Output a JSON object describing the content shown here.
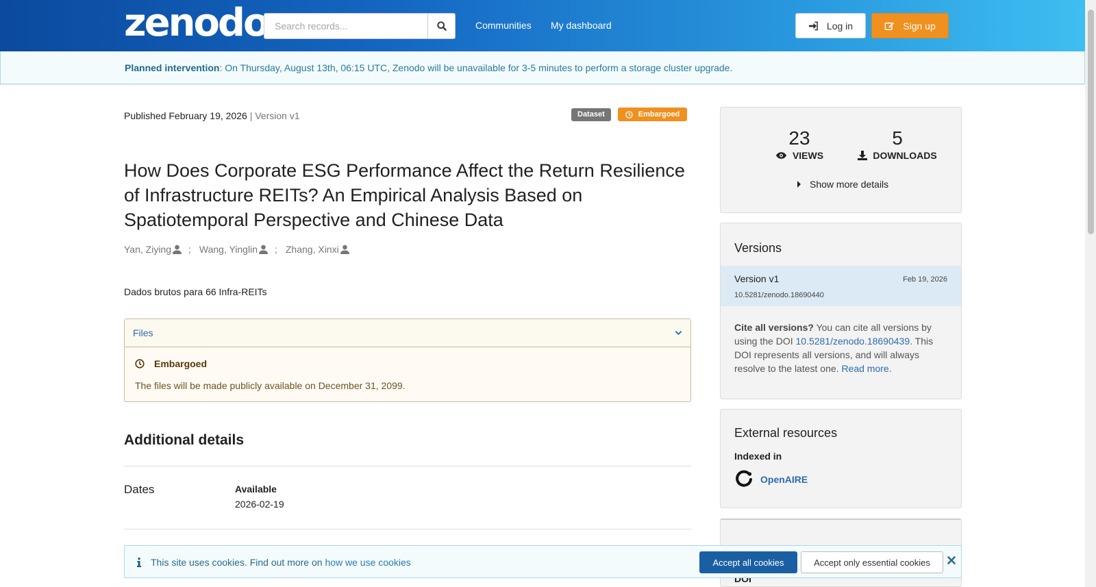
{
  "header": {
    "logo": "zenodo",
    "search_placeholder": "Search records...",
    "nav": [
      "Communities",
      "My dashboard"
    ],
    "login_label": "Log in",
    "signup_label": "Sign up"
  },
  "banner": {
    "bold": "Planned intervention",
    "text": ": On Thursday, August 13th, 06:15 UTC, Zenodo will be unavailable for 3-5 minutes to perform a storage cluster upgrade."
  },
  "record": {
    "published": "Published February 19, 2026",
    "version": "| Version v1",
    "badge_type": "Dataset",
    "badge_access": "Embargoed",
    "title": "How Does Corporate ESG Performance Affect the Return Resilience of Infrastructure REITs? An Empirical Analysis Based on Spatiotemporal Perspective and Chinese Data",
    "authors": [
      "Yan, Ziying",
      "Wang, Yinglin",
      "Zhang, Xinxi"
    ],
    "author_sep": ";",
    "description": "Dados brutos para 66 Infra-REITs"
  },
  "files": {
    "label": "Files",
    "embargo_title": "Embargoed",
    "embargo_text": "The files will be made publicly available on December 31, 2099."
  },
  "details": {
    "heading": "Additional details",
    "dates_label": "Dates",
    "available_label": "Available",
    "available_value": "2026-02-19"
  },
  "stats": {
    "views": "23",
    "views_label": "VIEWS",
    "downloads": "5",
    "downloads_label": "DOWNLOADS",
    "more": "Show more details"
  },
  "versions": {
    "heading": "Versions",
    "item_label": "Version v1",
    "item_date": "Feb 19, 2026",
    "item_doi": "10.5281/zenodo.18690440",
    "cite_bold": "Cite all versions?",
    "cite_text1": " You can cite all versions by using the DOI ",
    "cite_doi": "10.5281/zenodo.18690439",
    "cite_text2": ". This DOI represents all versions, and will always resolve to the latest one. ",
    "read_more": "Read more."
  },
  "external": {
    "heading": "External resources",
    "indexed": "Indexed in",
    "provider": "OpenAIRE"
  },
  "doi_card": {
    "label": "DOI"
  },
  "cookie": {
    "text": "This site uses cookies. Find out more on ",
    "link": "how we use cookies",
    "accept_all": "Accept all cookies",
    "accept_essential": "Accept only essential cookies"
  },
  "colors": {
    "accent_orange": "#f0901e",
    "link_blue": "#2b6cb0",
    "primary_blue": "#1a5fa3"
  }
}
